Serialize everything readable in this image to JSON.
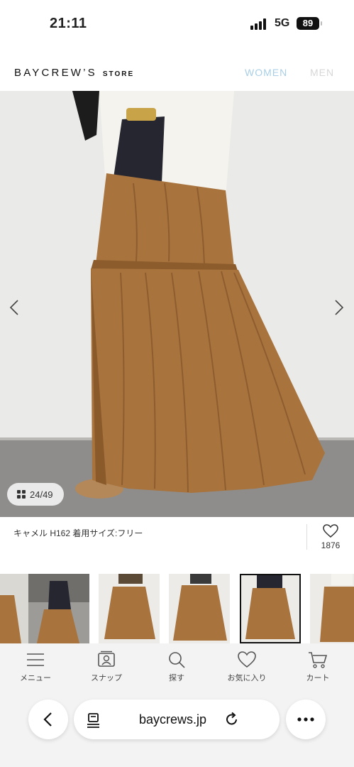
{
  "status_bar": {
    "time": "21:11",
    "network": "5G",
    "battery": "89"
  },
  "header": {
    "logo_main": "BAYCREW’S",
    "logo_sub": "STORE",
    "nav_women": "WOMEN",
    "nav_men": "MEN",
    "colors": {
      "women": "#a9cfe6",
      "men": "#d7d7d7"
    }
  },
  "gallery": {
    "counter": "24/49",
    "prev_icon": "chevron-left-icon",
    "next_icon": "chevron-right-icon",
    "skirt_color": "#a8733d"
  },
  "product": {
    "caption": "キャメル H162 着用サイズ:フリー",
    "favorite_count": "1876",
    "favorite_icon": "heart-icon"
  },
  "thumbnails": {
    "count": 6,
    "selected_index": 4
  },
  "bottom_nav": {
    "items": [
      {
        "label": "メニュー",
        "icon": "menu-icon"
      },
      {
        "label": "スナップ",
        "icon": "snap-icon"
      },
      {
        "label": "探す",
        "icon": "search-icon"
      },
      {
        "label": "お気に入り",
        "icon": "heart-icon"
      },
      {
        "label": "カート",
        "icon": "cart-icon"
      }
    ]
  },
  "browser": {
    "url": "baycrews.jp"
  }
}
